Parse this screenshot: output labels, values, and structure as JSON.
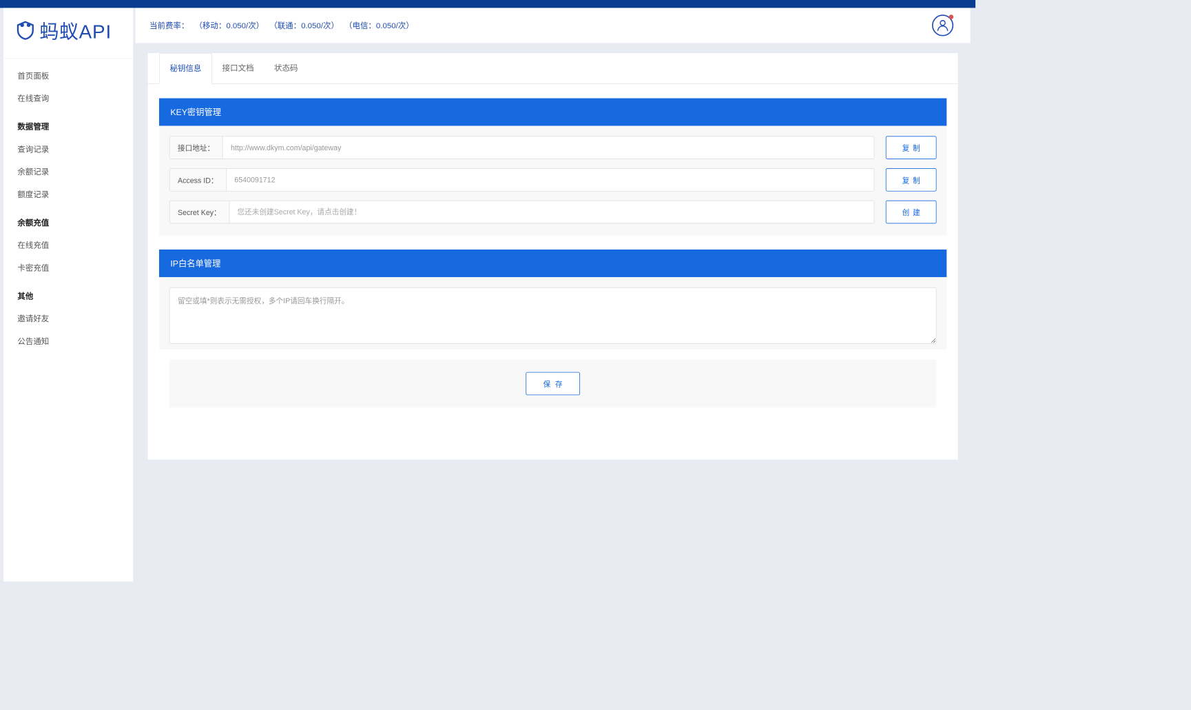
{
  "logo": {
    "text": "蚂蚁API"
  },
  "sidebar": {
    "items": [
      {
        "label": "首页面板",
        "group": false
      },
      {
        "label": "在线查询",
        "group": false
      },
      {
        "label": "数据管理",
        "group": true
      },
      {
        "label": "查询记录",
        "group": false
      },
      {
        "label": "余额记录",
        "group": false
      },
      {
        "label": "额度记录",
        "group": false
      },
      {
        "label": "余额充值",
        "group": true
      },
      {
        "label": "在线充值",
        "group": false
      },
      {
        "label": "卡密充值",
        "group": false
      },
      {
        "label": "其他",
        "group": true
      },
      {
        "label": "邀请好友",
        "group": false
      },
      {
        "label": "公告通知",
        "group": false
      }
    ]
  },
  "header": {
    "rate_prefix": "当前费率：",
    "rate_mobile": "（移动：0.050/次）",
    "rate_unicom": "（联通：0.050/次）",
    "rate_telecom": "（电信：0.050/次）"
  },
  "tabs": {
    "items": [
      {
        "label": "秘钥信息"
      },
      {
        "label": "接口文档"
      },
      {
        "label": "状态码"
      }
    ]
  },
  "key_section": {
    "title": "KEY密钥管理",
    "rows": {
      "api_url": {
        "label": "接口地址：",
        "value": "http://www.dkym.com/api/gateway",
        "btn": "复制"
      },
      "access_id": {
        "label": "Access ID：",
        "value": "6540091712",
        "btn": "复制"
      },
      "secret_key": {
        "label": "Secret Key：",
        "placeholder": "您还未创建Secret Key，请点击创建！",
        "value": "",
        "btn": "创建"
      }
    }
  },
  "whitelist_section": {
    "title": "IP白名单管理",
    "placeholder": "留空或填*则表示无需授权，多个IP请回车换行隔开。",
    "save_btn": "保存"
  }
}
